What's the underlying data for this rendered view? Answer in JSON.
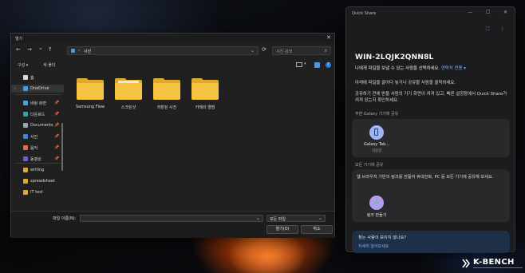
{
  "dialog": {
    "title": "열기",
    "close": "✕",
    "nav": {
      "back": "←",
      "forward": "→",
      "down": "⌄",
      "up": "↑"
    },
    "address": {
      "sep": "›",
      "path": "사진",
      "dropdown": "⌄"
    },
    "refresh": "⟳",
    "search_placeholder": "사진 검색",
    "search_icon": "⌕",
    "organize": "구성 ▾",
    "new_folder": "새 폴더",
    "view_dd": "▾",
    "help": "?",
    "sidebar": [
      {
        "label": "홈",
        "icon": "home-icon",
        "color": "#d9d9d9"
      },
      {
        "label": "OneDrive",
        "icon": "cloud-icon",
        "color": "#3aa0e8",
        "chevron": "›"
      },
      {
        "label": "바탕 화면",
        "icon": "desktop-icon",
        "color": "#4aa3e0",
        "pin": "📌"
      },
      {
        "label": "다운로드",
        "icon": "download-icon",
        "color": "#2aa7a7",
        "pin": "📌"
      },
      {
        "label": "Documents",
        "icon": "document-icon",
        "color": "#9aa6b8",
        "pin": "📌"
      },
      {
        "label": "사진",
        "icon": "picture-icon",
        "color": "#3b82d6",
        "pin": "📌"
      },
      {
        "label": "음악",
        "icon": "music-icon",
        "color": "#e26b4a",
        "pin": "📌"
      },
      {
        "label": "동영상",
        "icon": "video-icon",
        "color": "#7b55d1",
        "pin": "📌"
      },
      {
        "label": "writing",
        "icon": "folder-icon",
        "color": "#e0a92c"
      },
      {
        "label": "spreadsheet",
        "icon": "folder-icon",
        "color": "#e0a92c"
      },
      {
        "label": "IT test",
        "icon": "folder-icon",
        "color": "#e0a92c"
      }
    ],
    "folders": [
      {
        "label": "Samsung Flow",
        "has_paper": false
      },
      {
        "label": "스크린샷",
        "has_paper": true
      },
      {
        "label": "저장된 사진",
        "has_paper": false
      },
      {
        "label": "카메라 앨범",
        "has_paper": false
      }
    ],
    "filename_label": "파일 이름(N):",
    "filename_value": "",
    "filetype_value": "모든 파일",
    "open_button": "열기(O)",
    "cancel_button": "취소"
  },
  "quick_share": {
    "title": "Quick Share",
    "controls": {
      "minimize": "—",
      "maximize": "☐",
      "close": "✕"
    },
    "device_name": "WIN-2LQJK2QNN8L",
    "subtitle": "나에게 파일을 보낼 수 있는 사람을 선택하세요.",
    "subtitle_link": "연락처 전용 ▾",
    "description": "아래에 파일을 끌어다 놓거나 공유할 사람을 클릭하세요.",
    "description2": "공유하기 전에 받을 사람의 기기 화면이 켜져 있고, 빠른 설정창에서 Quick Share가 켜져 있는지 확인하세요.",
    "nearby_section": "주변 Galaxy 기기에 공유",
    "device": {
      "name": "Galaxy Tab...",
      "status": "대용량"
    },
    "all_devices_section": "모든 기기에 공유",
    "link_description": "웹 브라우저 기반의 링크를 만들어 휴대전화, PC 등 모든 기기에 공유해 보세요.",
    "link_label": "링크 만들기",
    "help_title": "찾는 사람이 보이지 않나요?",
    "help_link": "자세히 알아보세요"
  },
  "watermark": {
    "text": "K-BENCH"
  }
}
